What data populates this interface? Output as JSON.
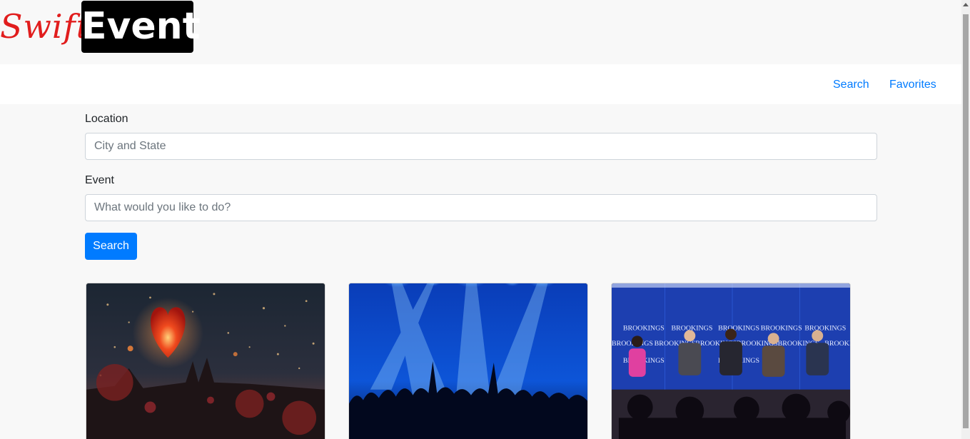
{
  "logo": {
    "swift": "Swift",
    "event": "Event"
  },
  "nav": {
    "search": "Search",
    "favorites": "Favorites"
  },
  "form": {
    "location_label": "Location",
    "location_placeholder": "City and State",
    "location_value": "",
    "event_label": "Event",
    "event_placeholder": "What would you like to do?",
    "event_value": "",
    "submit_label": "Search"
  },
  "cards": [
    {
      "image": "sky-lantern-festival-image"
    },
    {
      "image": "concert-crowd-image"
    },
    {
      "image": "brookings-panel-discussion-image"
    }
  ],
  "colors": {
    "accent": "#007bff",
    "logo_red": "#e11d1d",
    "logo_black": "#000000",
    "page_bg": "#f8f8f8"
  }
}
